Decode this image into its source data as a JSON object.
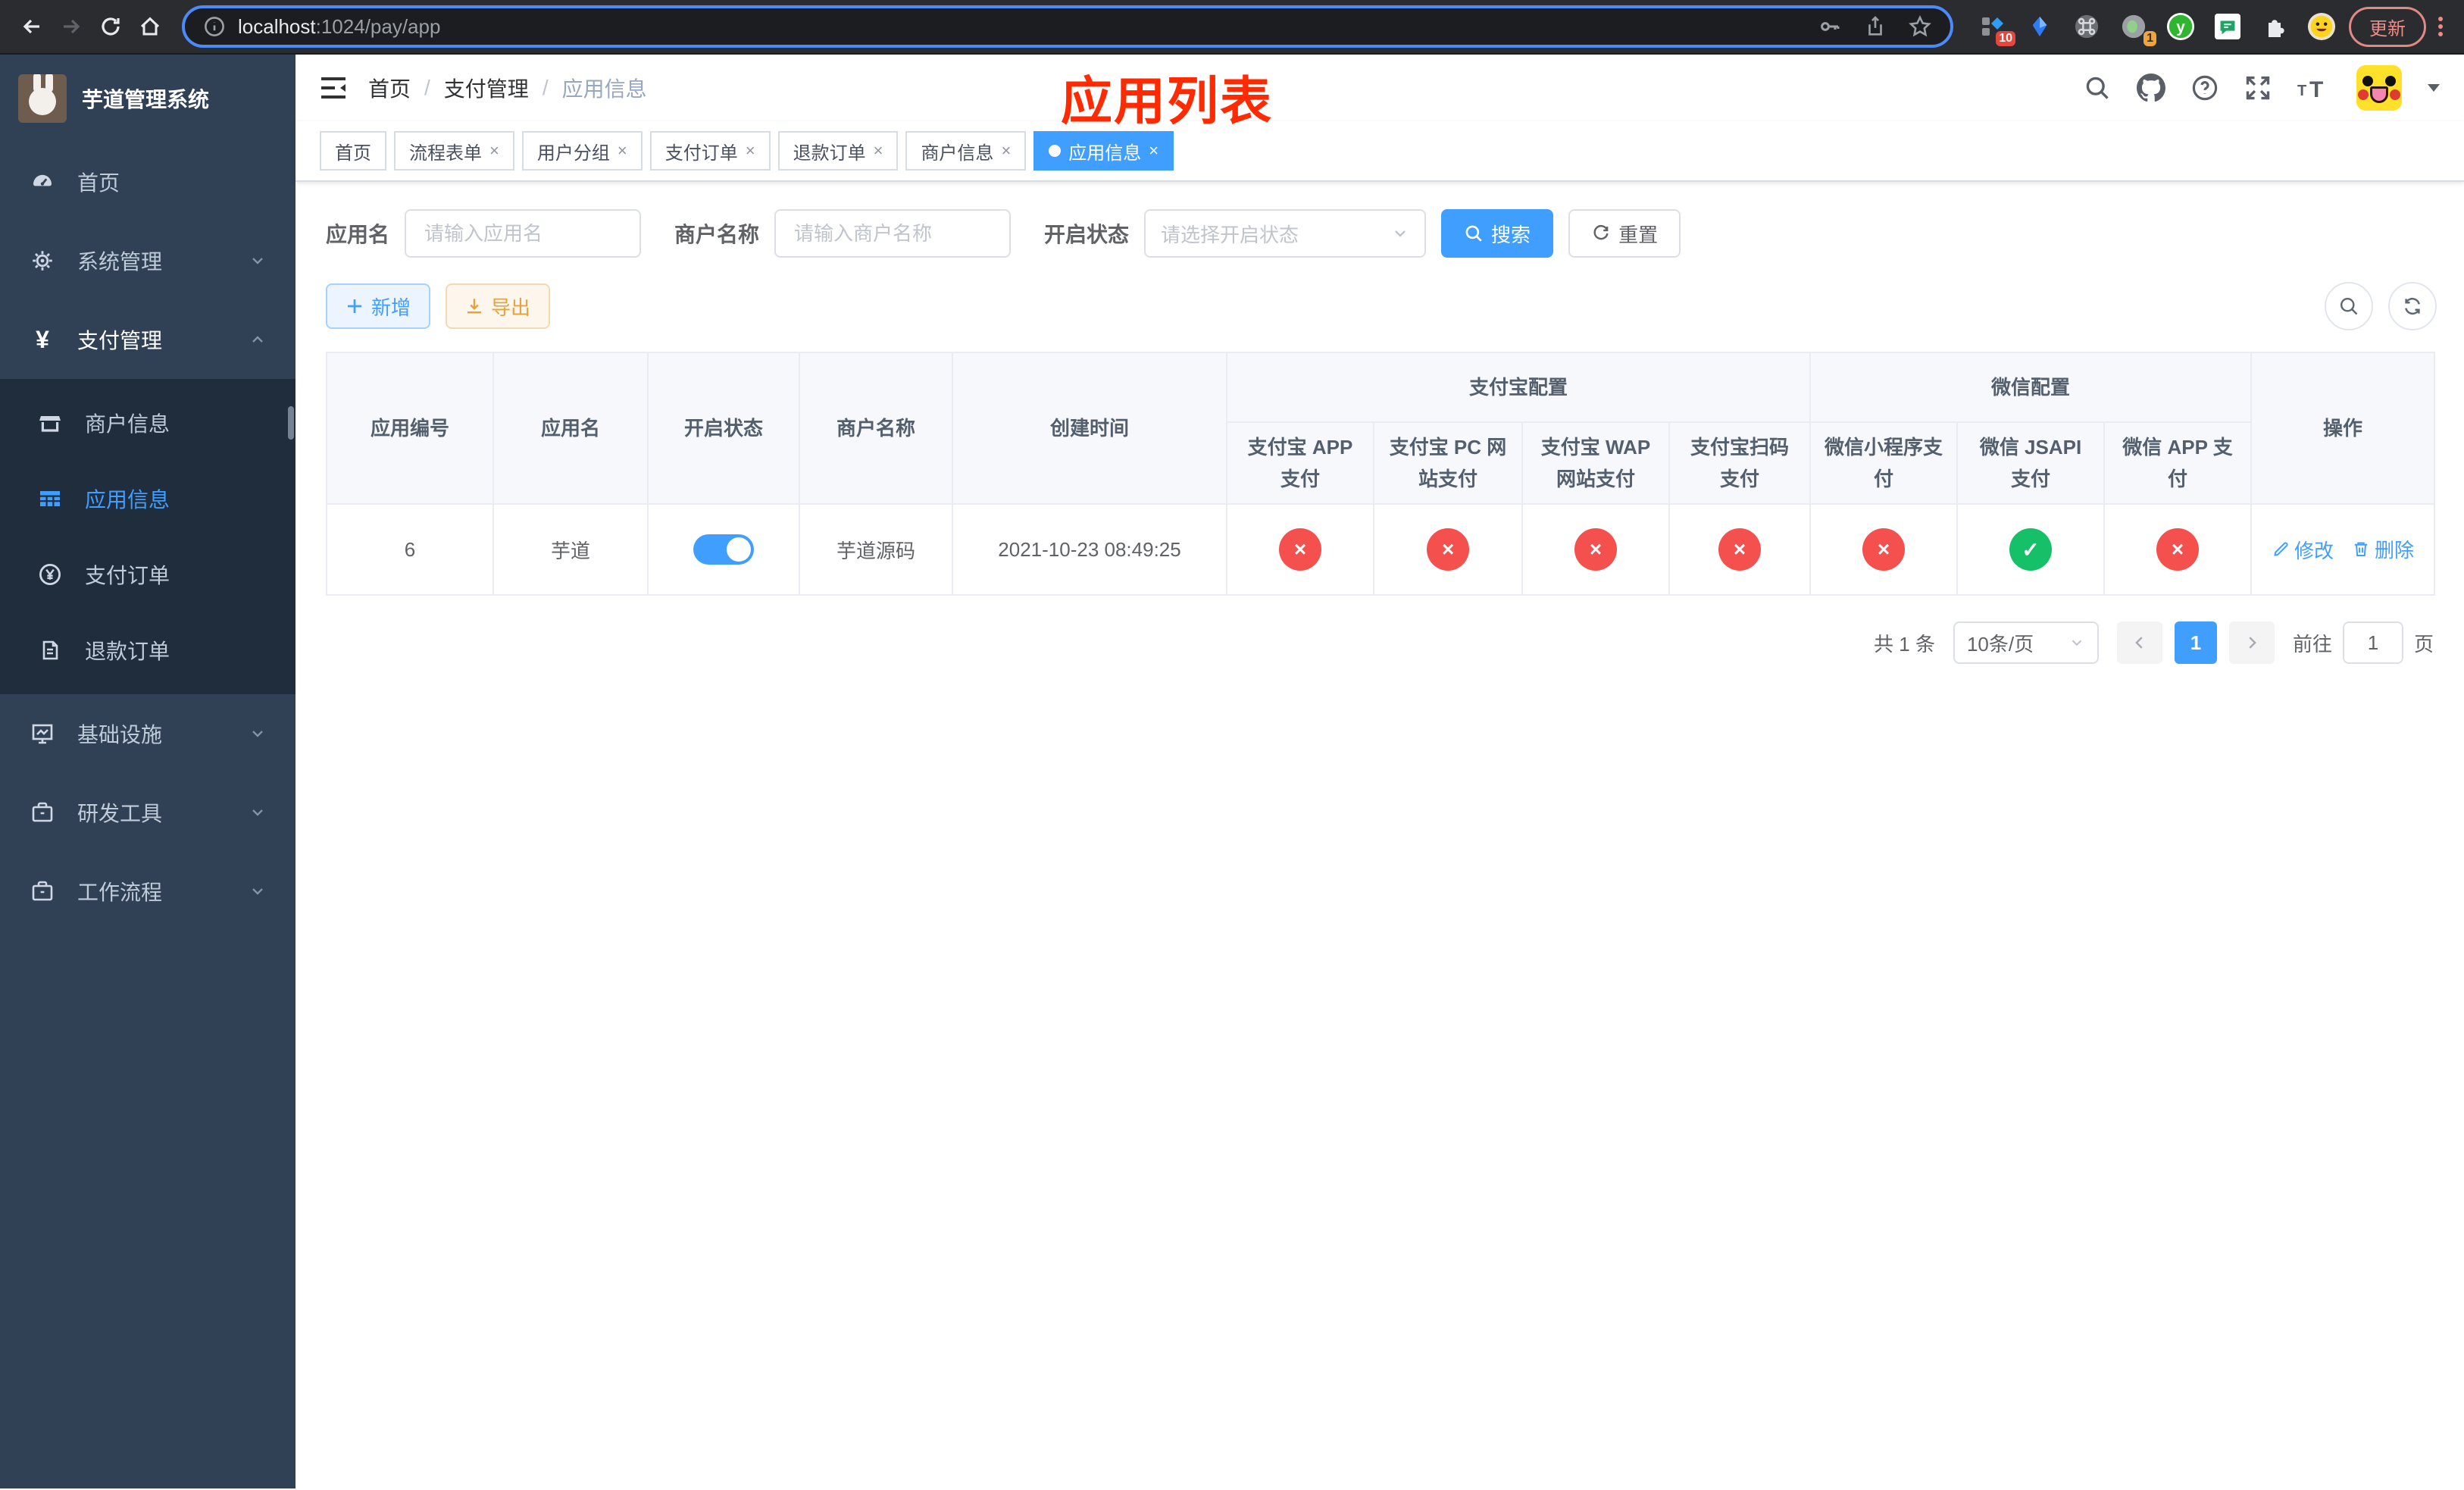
{
  "colors": {
    "accent": "#409eff",
    "danger": "#f4504d",
    "success": "#15c069",
    "annotation": "#ff2a00",
    "sidebar_bg": "#304156",
    "submenu_bg": "#1f2d3d"
  },
  "browser": {
    "url_host": "localhost",
    "url_path": ":1024/pay/app",
    "update_label": "更新",
    "extension_badge_1": "10",
    "extension_badge_2": "1"
  },
  "sidebar": {
    "title": "芋道管理系统",
    "items": [
      {
        "label": "首页"
      },
      {
        "label": "系统管理"
      },
      {
        "label": "支付管理"
      },
      {
        "label": "基础设施"
      },
      {
        "label": "研发工具"
      },
      {
        "label": "工作流程"
      }
    ],
    "payment_submenu": [
      {
        "label": "商户信息"
      },
      {
        "label": "应用信息"
      },
      {
        "label": "支付订单"
      },
      {
        "label": "退款订单"
      }
    ]
  },
  "header": {
    "breadcrumb": [
      "首页",
      "支付管理",
      "应用信息"
    ],
    "breadcrumb_separator": "/",
    "annotation": "应用列表"
  },
  "tabs": [
    {
      "label": "首页"
    },
    {
      "label": "流程表单"
    },
    {
      "label": "用户分组"
    },
    {
      "label": "支付订单"
    },
    {
      "label": "退款订单"
    },
    {
      "label": "商户信息"
    },
    {
      "label": "应用信息"
    }
  ],
  "filters": {
    "app_name_label": "应用名",
    "app_name_placeholder": "请输入应用名",
    "merchant_label": "商户名称",
    "merchant_placeholder": "请输入商户名称",
    "status_label": "开启状态",
    "status_placeholder": "请选择开启状态",
    "search_label": "搜索",
    "reset_label": "重置"
  },
  "toolbar": {
    "add_label": "新增",
    "export_label": "导出"
  },
  "table": {
    "groups": [
      "支付宝配置",
      "微信配置"
    ],
    "columns": [
      "应用编号",
      "应用名",
      "开启状态",
      "商户名称",
      "创建时间",
      "支付宝 APP 支付",
      "支付宝 PC 网站支付",
      "支付宝 WAP 网站支付",
      "支付宝扫码支付",
      "微信小程序支付",
      "微信 JSAPI 支付",
      "微信 APP 支付",
      "操作"
    ],
    "row": {
      "id": "6",
      "name": "芋道",
      "enabled": true,
      "merchant": "芋道源码",
      "created_at": "2021-10-23 08:49:25",
      "statuses": [
        "cross",
        "cross",
        "cross",
        "cross",
        "cross",
        "check",
        "cross"
      ],
      "edit_label": "修改",
      "delete_label": "删除"
    }
  },
  "pagination": {
    "total_text": "共 1 条",
    "page_size_text": "10条/页",
    "current_page": "1",
    "goto_prefix": "前往",
    "goto_value": "1",
    "goto_suffix": "页"
  },
  "icons": {
    "close": "×",
    "cross": "×",
    "check": "✓",
    "yen": "¥"
  }
}
